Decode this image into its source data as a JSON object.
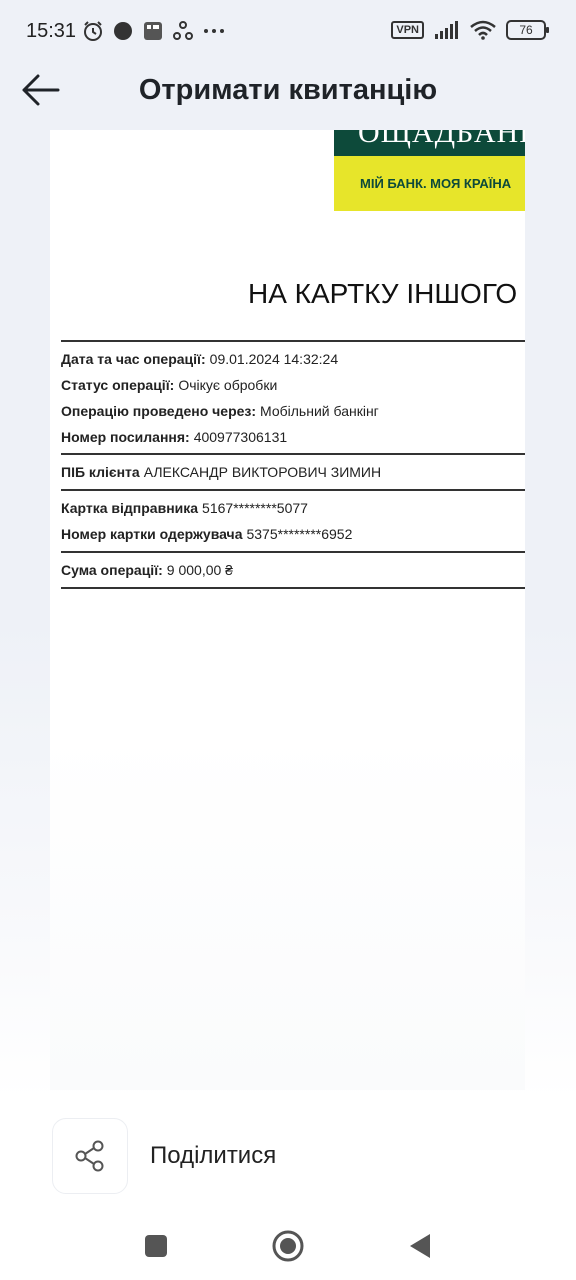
{
  "status_bar": {
    "time": "15:31",
    "vpn_label": "VPN",
    "battery_level": "76",
    "left_icons": [
      "alarm-icon",
      "dot-icon",
      "app-icon",
      "sync-icon",
      "more-dots-icon"
    ],
    "right_icons": [
      "vpn-icon",
      "signal-icon",
      "wifi-icon",
      "battery-icon"
    ]
  },
  "header": {
    "title": "Отримати квитанцію",
    "back_icon": "arrow-left-icon"
  },
  "receipt": {
    "bank_name": "ОЩАДБАНК",
    "bank_slogan": "МІЙ БАНК. МОЯ КРАЇНА",
    "heading": "НА КАРТКУ ІНШОГО",
    "rows": [
      {
        "label": "Дата та час операції:",
        "value": "09.01.2024 14:32:24"
      },
      {
        "label": "Статус операції:",
        "value": "Очікує обробки"
      },
      {
        "label": "Операцію проведено через:",
        "value": "Мобільний банкінг"
      },
      {
        "label": "Номер посилання:",
        "value": "400977306131"
      },
      {
        "label": "ПІБ клієнта",
        "value": "АЛЕКСАНДР ВИКТОРОВИЧ ЗИМИН"
      },
      {
        "label": "Картка відправника",
        "value": "5167********5077"
      },
      {
        "label": "Номер картки одержувача",
        "value": "5375********6952"
      },
      {
        "label": "Сума операції:",
        "value": "9 000,00 ₴"
      }
    ]
  },
  "share": {
    "label": "Поділитися",
    "icon": "share-icon"
  },
  "nav_bar": {
    "icons": [
      "square-recent-icon",
      "circle-home-icon",
      "triangle-back-icon"
    ]
  },
  "colors": {
    "bank_green": "#0d4a3a",
    "bank_yellow": "#e7e52a",
    "background": "#eef1f7"
  }
}
